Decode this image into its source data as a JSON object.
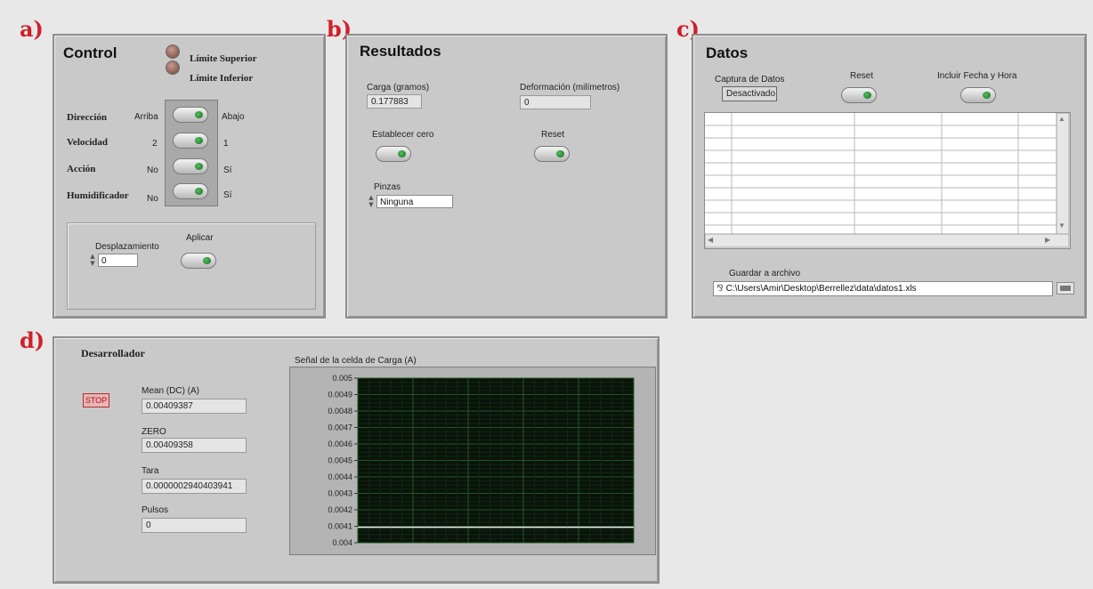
{
  "labels": {
    "a": "a)",
    "b": "b)",
    "c": "c)",
    "d": "d)"
  },
  "control": {
    "title": "Control",
    "limit_upper": "Límite Superior",
    "limit_lower": "Límite Inferior",
    "toggles": [
      {
        "name": "Dirección",
        "left": "Arriba",
        "right": "Abajo"
      },
      {
        "name": "Velocidad",
        "left": "2",
        "right": "1"
      },
      {
        "name": "Acción",
        "left": "No",
        "right": "Sí"
      },
      {
        "name": "Humidificador",
        "left": "No",
        "right": "Sí"
      }
    ],
    "displacement_label": "Desplazamiento",
    "displacement_value": "0",
    "apply_label": "Aplicar"
  },
  "results": {
    "title": "Resultados",
    "load_label": "Carga (gramos)",
    "load_value": "0.177883",
    "deformation_label": "Deformación (milímetros)",
    "deformation_value": "0",
    "zero_label": "Establecer cero",
    "reset_label": "Reset",
    "clamps_label": "Pinzas",
    "clamps_value": "Ninguna"
  },
  "data_panel": {
    "title": "Datos",
    "capture_label": "Captura de Datos",
    "capture_state": "Desactivado",
    "reset_label": "Reset",
    "include_date_label": "Incluir Fecha y Hora",
    "save_label": "Guardar a archivo",
    "save_path": "C:\\Users\\Amir\\Desktop\\Berrellez\\data\\datos1.xls"
  },
  "developer": {
    "title": "Desarrollador",
    "stop_label": "STOP",
    "mean_label": "Mean (DC) (A)",
    "mean_value": "0.00409387",
    "zero_label": "ZERO",
    "zero_value": "0.00409358",
    "tare_label": "Tara",
    "tare_value": "0.0000002940403941",
    "pulses_label": "Pulsos",
    "pulses_value": "0"
  },
  "chart_data": {
    "type": "line",
    "title": "Señal de la celda de Carga (A)",
    "ylim": [
      0.004,
      0.005
    ],
    "yticks": [
      "0.005",
      "0.0049",
      "0.0048",
      "0.0047",
      "0.0046",
      "0.0045",
      "0.0044",
      "0.0043",
      "0.0042",
      "0.0041",
      "0.004"
    ],
    "series": [
      {
        "values": [
          0.00409387,
          0.00409387
        ]
      }
    ],
    "grid": true,
    "colors": {
      "background": "#0a120a",
      "grid": "#1f5a22",
      "line": "#e8e8e8"
    }
  }
}
